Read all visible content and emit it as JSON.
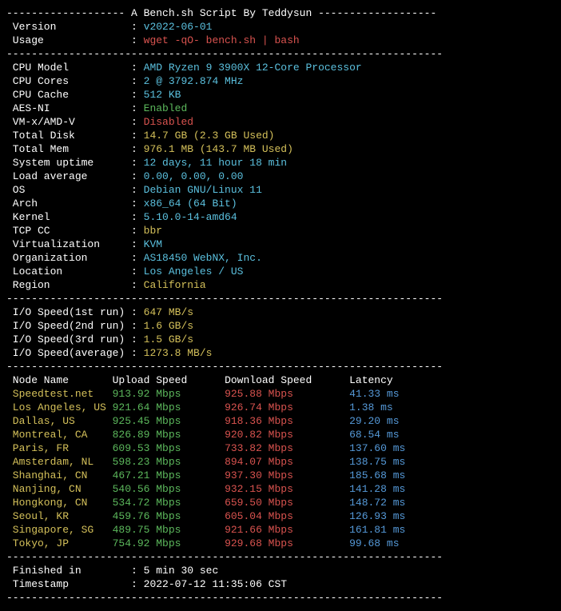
{
  "header": {
    "divider_title": "------------------- A Bench.sh Script By Teddysun -------------------",
    "version_label": " Version            : ",
    "version_value": "v2022-06-01",
    "usage_label": " Usage              : ",
    "usage_value": "wget -qO- bench.sh | bash"
  },
  "divider": "----------------------------------------------------------------------",
  "sys": [
    {
      "label": " CPU Model          : ",
      "value": "AMD Ryzen 9 3900X 12-Core Processor",
      "cls": "c-cyan"
    },
    {
      "label": " CPU Cores          : ",
      "value": "2 @ 3792.874 MHz",
      "cls": "c-cyan"
    },
    {
      "label": " CPU Cache          : ",
      "value": "512 KB",
      "cls": "c-cyan"
    },
    {
      "label": " AES-NI             : ",
      "value": "Enabled",
      "cls": "c-green"
    },
    {
      "label": " VM-x/AMD-V         : ",
      "value": "Disabled",
      "cls": "c-red"
    },
    {
      "label": " Total Disk         : ",
      "value": "14.7 GB (2.3 GB Used)",
      "cls": "c-yellow"
    },
    {
      "label": " Total Mem          : ",
      "value": "976.1 MB (143.7 MB Used)",
      "cls": "c-yellow"
    },
    {
      "label": " System uptime      : ",
      "value": "12 days, 11 hour 18 min",
      "cls": "c-cyan"
    },
    {
      "label": " Load average       : ",
      "value": "0.00, 0.00, 0.00",
      "cls": "c-cyan"
    },
    {
      "label": " OS                 : ",
      "value": "Debian GNU/Linux 11",
      "cls": "c-cyan"
    },
    {
      "label": " Arch               : ",
      "value": "x86_64 (64 Bit)",
      "cls": "c-cyan"
    },
    {
      "label": " Kernel             : ",
      "value": "5.10.0-14-amd64",
      "cls": "c-cyan"
    },
    {
      "label": " TCP CC             : ",
      "value": "bbr",
      "cls": "c-yellow"
    },
    {
      "label": " Virtualization     : ",
      "value": "KVM",
      "cls": "c-cyan"
    },
    {
      "label": " Organization       : ",
      "value": "AS18450 WebNX, Inc.",
      "cls": "c-cyan"
    },
    {
      "label": " Location           : ",
      "value": "Los Angeles / US",
      "cls": "c-cyan"
    },
    {
      "label": " Region             : ",
      "value": "California",
      "cls": "c-yellow"
    }
  ],
  "io": [
    {
      "label": " I/O Speed(1st run) : ",
      "value": "647 MB/s"
    },
    {
      "label": " I/O Speed(2nd run) : ",
      "value": "1.6 GB/s"
    },
    {
      "label": " I/O Speed(3rd run) : ",
      "value": "1.5 GB/s"
    },
    {
      "label": " I/O Speed(average) : ",
      "value": "1273.8 MB/s"
    }
  ],
  "net_header": {
    "node": " Node Name",
    "upload": "Upload Speed",
    "download": "Download Speed",
    "latency": "Latency"
  },
  "net": [
    {
      "node": " Speedtest.net",
      "up": "913.92 Mbps",
      "down": "925.88 Mbps",
      "lat": "41.33 ms"
    },
    {
      "node": " Los Angeles, US",
      "up": "921.64 Mbps",
      "down": "926.74 Mbps",
      "lat": "1.38 ms"
    },
    {
      "node": " Dallas, US",
      "up": "925.45 Mbps",
      "down": "918.36 Mbps",
      "lat": "29.20 ms"
    },
    {
      "node": " Montreal, CA",
      "up": "826.89 Mbps",
      "down": "920.82 Mbps",
      "lat": "68.54 ms"
    },
    {
      "node": " Paris, FR",
      "up": "609.53 Mbps",
      "down": "733.82 Mbps",
      "lat": "137.60 ms"
    },
    {
      "node": " Amsterdam, NL",
      "up": "598.23 Mbps",
      "down": "894.07 Mbps",
      "lat": "138.75 ms"
    },
    {
      "node": " Shanghai, CN",
      "up": "467.21 Mbps",
      "down": "937.30 Mbps",
      "lat": "185.68 ms"
    },
    {
      "node": " Nanjing, CN",
      "up": "540.56 Mbps",
      "down": "932.15 Mbps",
      "lat": "141.28 ms"
    },
    {
      "node": " Hongkong, CN",
      "up": "534.72 Mbps",
      "down": "659.50 Mbps",
      "lat": "148.72 ms"
    },
    {
      "node": " Seoul, KR",
      "up": "459.76 Mbps",
      "down": "605.04 Mbps",
      "lat": "126.93 ms"
    },
    {
      "node": " Singapore, SG",
      "up": "489.75 Mbps",
      "down": "921.66 Mbps",
      "lat": "161.81 ms"
    },
    {
      "node": " Tokyo, JP",
      "up": "754.92 Mbps",
      "down": "929.68 Mbps",
      "lat": "99.68 ms"
    }
  ],
  "footer": {
    "finished_label": " Finished in        : ",
    "finished_value": "5 min 30 sec",
    "timestamp_label": " Timestamp          : ",
    "timestamp_value": "2022-07-12 11:35:06 CST"
  }
}
